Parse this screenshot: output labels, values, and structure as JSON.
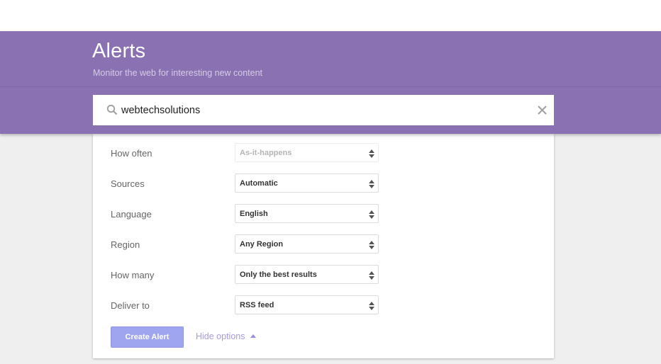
{
  "header": {
    "title": "Alerts",
    "subtitle": "Monitor the web for interesting new content",
    "color": "#8a72b2"
  },
  "search": {
    "value": "webtechsolutions",
    "icon": "search-icon",
    "clear_icon": "close-icon"
  },
  "options": [
    {
      "label": "How often",
      "value": "As-it-happens",
      "disabled": true
    },
    {
      "label": "Sources",
      "value": "Automatic",
      "disabled": false
    },
    {
      "label": "Language",
      "value": "English",
      "disabled": false
    },
    {
      "label": "Region",
      "value": "Any Region",
      "disabled": false
    },
    {
      "label": "How many",
      "value": "Only the best results",
      "disabled": false
    },
    {
      "label": "Deliver to",
      "value": "RSS feed",
      "disabled": false
    }
  ],
  "actions": {
    "create_label": "Create Alert",
    "hide_options_label": "Hide options"
  }
}
